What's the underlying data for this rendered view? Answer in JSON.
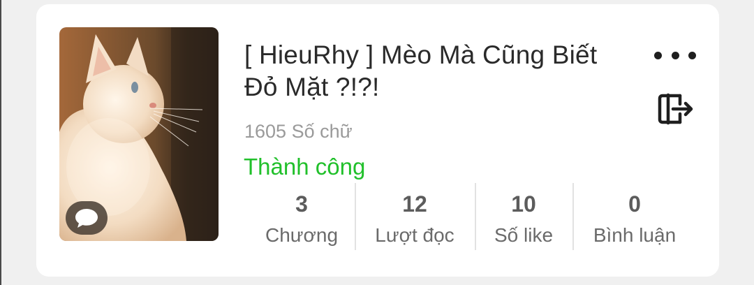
{
  "story": {
    "title": "[ HieuRhy ] Mèo Mà Cũng Biết Đỏ Mặt ?!?!",
    "word_count": "1605 Số chữ",
    "status": "Thành công",
    "status_color": "#21c02b"
  },
  "cover": {
    "description_icon": "chat-bubble-icon"
  },
  "actions": {
    "more_icon": "more-dots-icon",
    "exit_icon": "exit-door-icon"
  },
  "stats": [
    {
      "value": "3",
      "label": "Chương"
    },
    {
      "value": "12",
      "label": "Lượt đọc"
    },
    {
      "value": "10",
      "label": "Số like"
    },
    {
      "value": "0",
      "label": "Bình luận"
    }
  ]
}
